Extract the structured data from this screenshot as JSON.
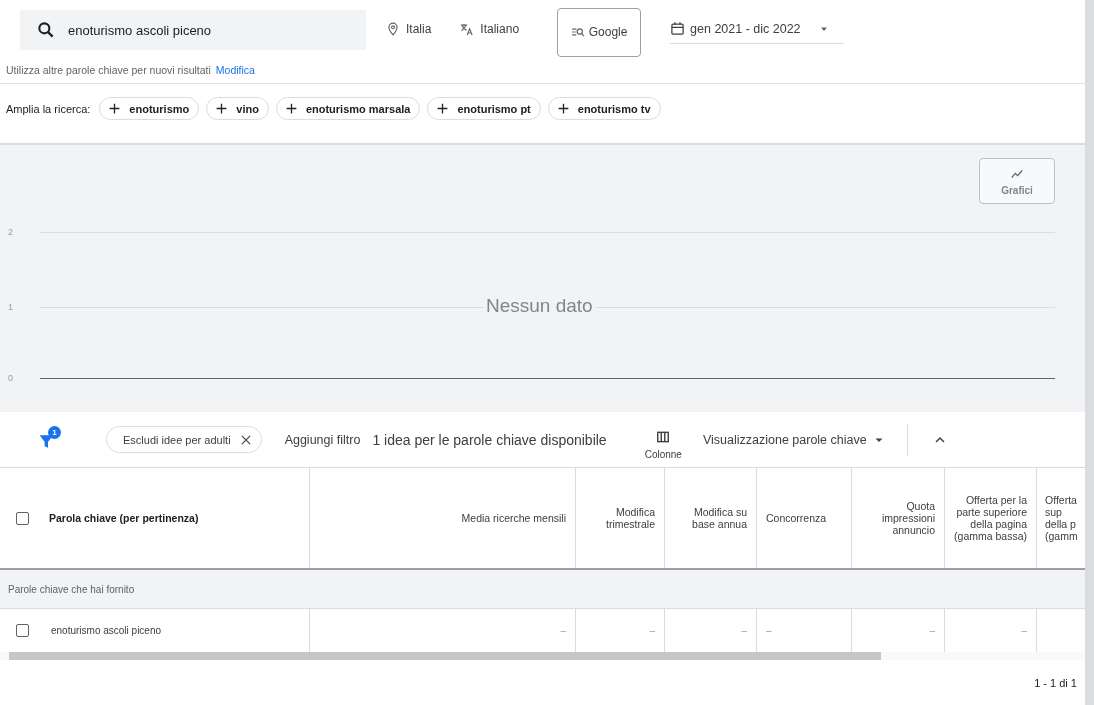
{
  "search": {
    "value": "enoturismo ascoli piceno"
  },
  "location": "Italia",
  "language": "Italiano",
  "network": "Google",
  "date_range": "gen 2021 - dic 2022",
  "hint": {
    "text": "Utilizza altre parole chiave per nuovi risultati",
    "link": "Modifica"
  },
  "broaden": {
    "label": "Amplia la ricerca:",
    "chips": [
      "enoturismo",
      "vino",
      "enoturismo marsala",
      "enoturismo pt",
      "enoturismo tv"
    ]
  },
  "chart": {
    "button": "Grafici",
    "y_labels": [
      "2",
      "1",
      "0"
    ],
    "empty_message": "Nessun dato"
  },
  "toolbar": {
    "filter_count": "1",
    "filter_chip": "Escludi idee per adulti",
    "add_filter": "Aggiungi filtro",
    "result_count": "1 idea per le parole chiave disponibile",
    "columns_button": "Colonne",
    "view": "Visualizzazione parole chiave",
    "collapsed": false
  },
  "table": {
    "columns": [
      {
        "label": "Parola chiave (per pertinenza)",
        "kind": "text"
      },
      {
        "label": "Media ricerche mensili",
        "kind": "numeric"
      },
      {
        "label": "Modifica trimestrale",
        "kind": "numeric"
      },
      {
        "label": "Modifica su base annua",
        "kind": "numeric"
      },
      {
        "label": "Concorrenza",
        "kind": "text"
      },
      {
        "label": "Quota impressioni annuncio",
        "kind": "numeric"
      },
      {
        "label": "Offerta per la parte superiore della pagina (gamma bassa)",
        "kind": "numeric"
      },
      {
        "label": "Offerta\nsup\ndella p\n(gamm",
        "kind": "cut"
      }
    ],
    "header_checked": false,
    "group": "Parole chiave che hai fornito",
    "rows": [
      {
        "checked": false,
        "cells": [
          "enoturismo ascoli piceno",
          "–",
          "–",
          "–",
          "–",
          "–",
          "–"
        ]
      }
    ]
  },
  "pagination": "1 - 1 di 1"
}
